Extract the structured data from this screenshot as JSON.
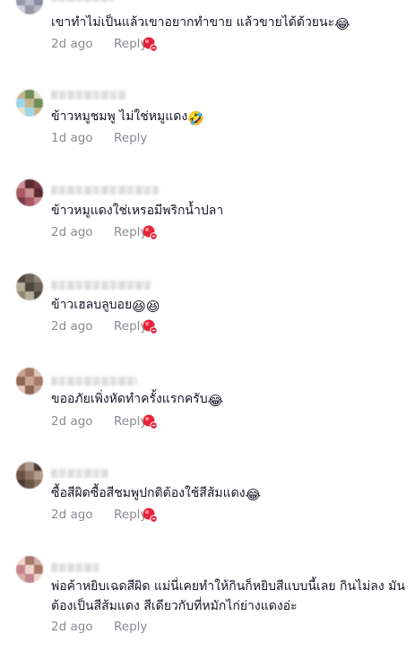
{
  "comments": [
    {
      "text": "เขาทำไม่เป็นแล้วเขาอยากทำขาย แล้วขายได้ด้วยนะ",
      "emojis": [
        "😂"
      ],
      "date": "2d ago",
      "reply": "Reply",
      "reaction": true
    },
    {
      "text": "ข้าวหมูชมพู ไม่ใช่หมูแดง",
      "emojis": [
        "🤣"
      ],
      "date": "1d ago",
      "reply": "Reply",
      "reaction": false
    },
    {
      "text": "ข้าวหมูแดงใช่เหรอมีพริกน้ำปลา",
      "emojis": [],
      "date": "2d ago",
      "reply": "Reply",
      "reaction": true
    },
    {
      "text": "ข้าวเฮลบลูบอย",
      "emojis": [
        "😆",
        "😆"
      ],
      "date": "2d ago",
      "reply": "Reply",
      "reaction": true
    },
    {
      "text": "ขออภัยเพิ่งหัดทำครั้งแรกครับ",
      "emojis": [
        "😂"
      ],
      "date": "2d ago",
      "reply": "Reply",
      "reaction": true
    },
    {
      "text": "ซื้อสีผิดซื้อสีชมพูปกติต้องใช้สีส้มแดง",
      "emojis": [
        "😂"
      ],
      "date": "2d ago",
      "reply": "Reply",
      "reaction": true
    },
    {
      "text": "พ่อค้าหยิบเฉดสีผิด แม่นี่เคยทำให้กินก็หยิบสีแบบนี้เลย กินไม่ลง มันต้องเป็นสีส้มแดง สีเดียวกับที่หมักไก่ย่างแดงอ่ะ",
      "emojis": [],
      "date": "2d ago",
      "reply": "Reply",
      "reaction": false
    }
  ],
  "colors": {
    "text": "#161823",
    "meta": "#8a8b91",
    "reaction_red": "#e5243b"
  },
  "icons": {
    "reaction": "red-sticker-reaction-icon"
  }
}
